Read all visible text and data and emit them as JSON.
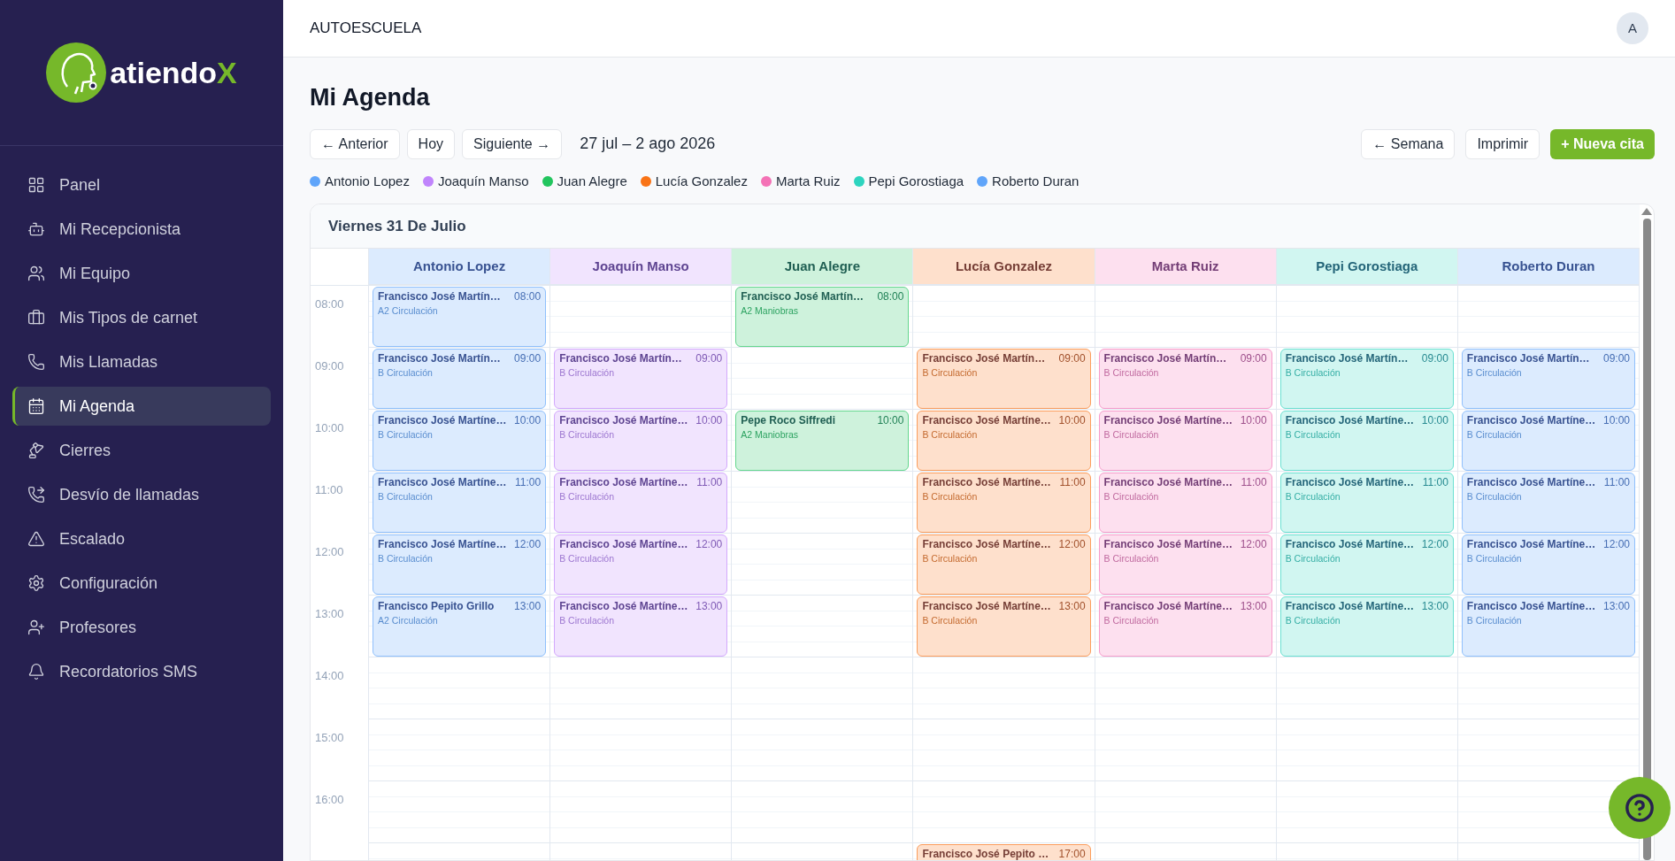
{
  "sidebar": {
    "logo": {
      "text": "atiendo",
      "accent": "X"
    },
    "items": [
      {
        "label": "Panel",
        "selected": false
      },
      {
        "label": "Mi Recepcionista",
        "selected": false
      },
      {
        "label": "Mi Equipo",
        "selected": false
      },
      {
        "label": "Mis Tipos de carnet",
        "selected": false
      },
      {
        "label": "Mis Llamadas",
        "selected": false
      },
      {
        "label": "Mi Agenda",
        "selected": true
      },
      {
        "label": "Cierres",
        "selected": false
      },
      {
        "label": "Desvío de llamadas",
        "selected": false
      },
      {
        "label": "Escalado",
        "selected": false
      },
      {
        "label": "Configuración",
        "selected": false
      },
      {
        "label": "Profesores",
        "selected": false
      },
      {
        "label": "Recordatorios SMS",
        "selected": false
      }
    ]
  },
  "header": {
    "title": "AUTOESCUELA",
    "avatar": "A"
  },
  "page_title": "Mi Agenda",
  "nav_buttons": [
    "← Anterior",
    "Hoy",
    "Siguiente →"
  ],
  "date_range": "27 jul – 2 ago 2026",
  "action_buttons": [
    {
      "label": "← Semana",
      "kind": "outline"
    },
    {
      "label": "Imprimir",
      "kind": "outline"
    },
    {
      "label": "+ Nueva cita",
      "kind": "primary"
    }
  ],
  "legend": [
    {
      "name": "Antonio Lopez",
      "color": "#60a5fa"
    },
    {
      "name": "Joaquín Manso",
      "color": "#c084fc"
    },
    {
      "name": "Juan Alegre",
      "color": "#22c55e"
    },
    {
      "name": "Lucía Gonzalez",
      "color": "#f97316"
    },
    {
      "name": "Marta Ruiz",
      "color": "#f472b6"
    },
    {
      "name": "Pepi Gorostiaga",
      "color": "#2dd4bf"
    },
    {
      "name": "Roberto Duran",
      "color": "#60a5fa"
    }
  ],
  "calendar": {
    "day_title": "Viernes 31 De Julio",
    "hours": [
      "08:00",
      "09:00",
      "10:00",
      "11:00",
      "12:00",
      "13:00",
      "14:00",
      "15:00",
      "16:00"
    ],
    "columns": [
      {
        "name": "Antonio Lopez",
        "slots": [
          {
            "kind": "appointment",
            "title": "Francisco José Martín…",
            "time": "08:00",
            "detail": "A2 Circulación"
          },
          {
            "kind": "appointment",
            "title": "Francisco José Martín…",
            "time": "09:00",
            "detail": "B Circulación"
          },
          {
            "kind": "appointment",
            "title": "Francisco José Martíne…",
            "time": "10:00",
            "detail": "B Circulación"
          },
          {
            "kind": "appointment",
            "title": "Francisco José Martíne…",
            "time": "11:00",
            "detail": "B Circulación"
          },
          {
            "kind": "appointment",
            "title": "Francisco José Martíne…",
            "time": "12:00",
            "detail": "B Circulación"
          },
          {
            "kind": "appointment",
            "title": "Francisco Pepito Grillo",
            "time": "13:00",
            "detail": "A2 Circulación"
          },
          {
            "kind": "empty"
          },
          {
            "kind": "empty"
          },
          {
            "kind": "empty"
          },
          {
            "kind": "empty"
          }
        ]
      },
      {
        "name": "Joaquín Manso",
        "slots": [
          {
            "kind": "empty"
          },
          {
            "kind": "appointment",
            "title": "Francisco José Martín…",
            "time": "09:00",
            "detail": "B Circulación"
          },
          {
            "kind": "appointment",
            "title": "Francisco José Martíne…",
            "time": "10:00",
            "detail": "B Circulación"
          },
          {
            "kind": "appointment",
            "title": "Francisco José Martíne…",
            "time": "11:00",
            "detail": "B Circulación"
          },
          {
            "kind": "appointment",
            "title": "Francisco José Martíne…",
            "time": "12:00",
            "detail": "B Circulación"
          },
          {
            "kind": "appointment",
            "title": "Francisco José Martíne…",
            "time": "13:00",
            "detail": "B Circulación"
          },
          {
            "kind": "empty"
          },
          {
            "kind": "empty"
          },
          {
            "kind": "empty"
          },
          {
            "kind": "empty"
          }
        ]
      },
      {
        "name": "Juan Alegre",
        "slots": [
          {
            "kind": "appointment",
            "title": "Francisco José Martín…",
            "time": "08:00",
            "detail": "A2 Maniobras"
          },
          {
            "kind": "empty"
          },
          {
            "kind": "appointment",
            "title": "Pepe Roco Siffredi",
            "time": "10:00",
            "detail": "A2 Maniobras"
          },
          {
            "kind": "empty"
          },
          {
            "kind": "empty"
          },
          {
            "kind": "empty"
          },
          {
            "kind": "empty"
          },
          {
            "kind": "empty"
          },
          {
            "kind": "empty"
          },
          {
            "kind": "empty"
          }
        ]
      },
      {
        "name": "Lucía Gonzalez",
        "slots": [
          {
            "kind": "empty"
          },
          {
            "kind": "appointment",
            "title": "Francisco José Martín…",
            "time": "09:00",
            "detail": "B Circulación"
          },
          {
            "kind": "appointment",
            "title": "Francisco José Martíne…",
            "time": "10:00",
            "detail": "B Circulación"
          },
          {
            "kind": "appointment",
            "title": "Francisco José Martíne…",
            "time": "11:00",
            "detail": "B Circulación"
          },
          {
            "kind": "appointment",
            "title": "Francisco José Martíne…",
            "time": "12:00",
            "detail": "B Circulación"
          },
          {
            "kind": "appointment",
            "title": "Francisco José Martíne…",
            "time": "13:00",
            "detail": "B Circulación"
          },
          {
            "kind": "empty"
          },
          {
            "kind": "empty"
          },
          {
            "kind": "empty"
          },
          {
            "kind": "appointment",
            "title": "Francisco José Pepito …",
            "time": "17:00"
          }
        ]
      },
      {
        "name": "Marta Ruiz",
        "slots": [
          {
            "kind": "empty"
          },
          {
            "kind": "appointment",
            "title": "Francisco José Martín…",
            "time": "09:00",
            "detail": "B Circulación"
          },
          {
            "kind": "appointment",
            "title": "Francisco José Martíne…",
            "time": "10:00",
            "detail": "B Circulación"
          },
          {
            "kind": "appointment",
            "title": "Francisco José Martíne…",
            "time": "11:00",
            "detail": "B Circulación"
          },
          {
            "kind": "appointment",
            "title": "Francisco José Martíne…",
            "time": "12:00",
            "detail": "B Circulación"
          },
          {
            "kind": "appointment",
            "title": "Francisco José Martíne…",
            "time": "13:00",
            "detail": "B Circulación"
          },
          {
            "kind": "empty"
          },
          {
            "kind": "empty"
          },
          {
            "kind": "empty"
          },
          {
            "kind": "empty"
          }
        ]
      },
      {
        "name": "Pepi Gorostiaga",
        "slots": [
          {
            "kind": "empty"
          },
          {
            "kind": "appointment",
            "title": "Francisco José Martín…",
            "time": "09:00",
            "detail": "B Circulación"
          },
          {
            "kind": "appointment",
            "title": "Francisco José Martíne…",
            "time": "10:00",
            "detail": "B Circulación"
          },
          {
            "kind": "appointment",
            "title": "Francisco José Martíne…",
            "time": "11:00",
            "detail": "B Circulación"
          },
          {
            "kind": "appointment",
            "title": "Francisco José Martíne…",
            "time": "12:00",
            "detail": "B Circulación"
          },
          {
            "kind": "appointment",
            "title": "Francisco José Martíne…",
            "time": "13:00",
            "detail": "B Circulación"
          },
          {
            "kind": "empty"
          },
          {
            "kind": "empty"
          },
          {
            "kind": "empty"
          },
          {
            "kind": "empty"
          }
        ]
      },
      {
        "name": "Roberto Duran",
        "slots": [
          {
            "kind": "empty"
          },
          {
            "kind": "appointment",
            "title": "Francisco José Martín…",
            "time": "09:00",
            "detail": "B Circulación"
          },
          {
            "kind": "appointment",
            "title": "Francisco José Martíne…",
            "time": "10:00",
            "detail": "B Circulación"
          },
          {
            "kind": "appointment",
            "title": "Francisco José Martíne…",
            "time": "11:00",
            "detail": "B Circulación"
          },
          {
            "kind": "appointment",
            "title": "Francisco José Martíne…",
            "time": "12:00",
            "detail": "B Circulación"
          },
          {
            "kind": "appointment",
            "title": "Francisco José Martíne…",
            "time": "13:00",
            "detail": "B Circulación"
          },
          {
            "kind": "empty"
          },
          {
            "kind": "empty"
          },
          {
            "kind": "empty"
          },
          {
            "kind": "empty"
          }
        ]
      }
    ]
  }
}
